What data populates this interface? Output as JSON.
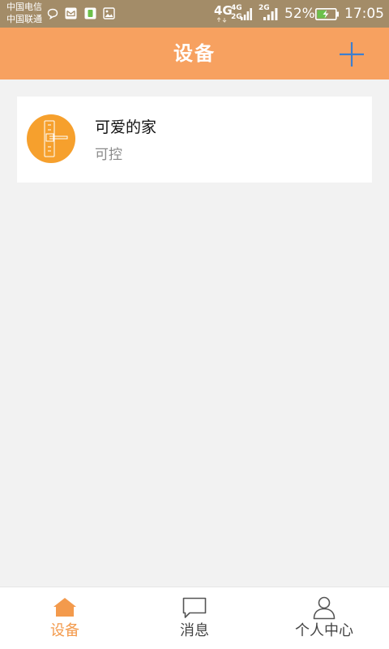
{
  "status_bar": {
    "carrier_1": "中国电信",
    "carrier_2": "中国联通",
    "network_1": "4G",
    "network_2_top": "4G",
    "network_2_bottom": "2G",
    "network_3": "2G",
    "battery_percent": "52%",
    "battery_level": 0.52,
    "time": "17:05",
    "icons": [
      "chat-bubble-icon",
      "mail-icon",
      "sim-card-icon",
      "image-icon",
      "signal-icon",
      "battery-charging-icon"
    ]
  },
  "header": {
    "title": "设备",
    "add_icon": "plus-icon"
  },
  "devices": [
    {
      "name": "可爱的家",
      "status": "可控",
      "icon": "door-lock-icon"
    }
  ],
  "bottom_nav": {
    "items": [
      {
        "label": "设备",
        "icon": "home-icon",
        "active": true
      },
      {
        "label": "消息",
        "icon": "message-icon",
        "active": false
      },
      {
        "label": "个人中心",
        "icon": "person-icon",
        "active": false
      }
    ]
  },
  "colors": {
    "status_bar": "#a38c68",
    "header": "#f7a160",
    "accent": "#f39a4c",
    "device_avatar": "#f6a02d",
    "background": "#f2f2f2",
    "add_icon": "#3d7fd0",
    "battery_fill": "#6cc04a"
  }
}
